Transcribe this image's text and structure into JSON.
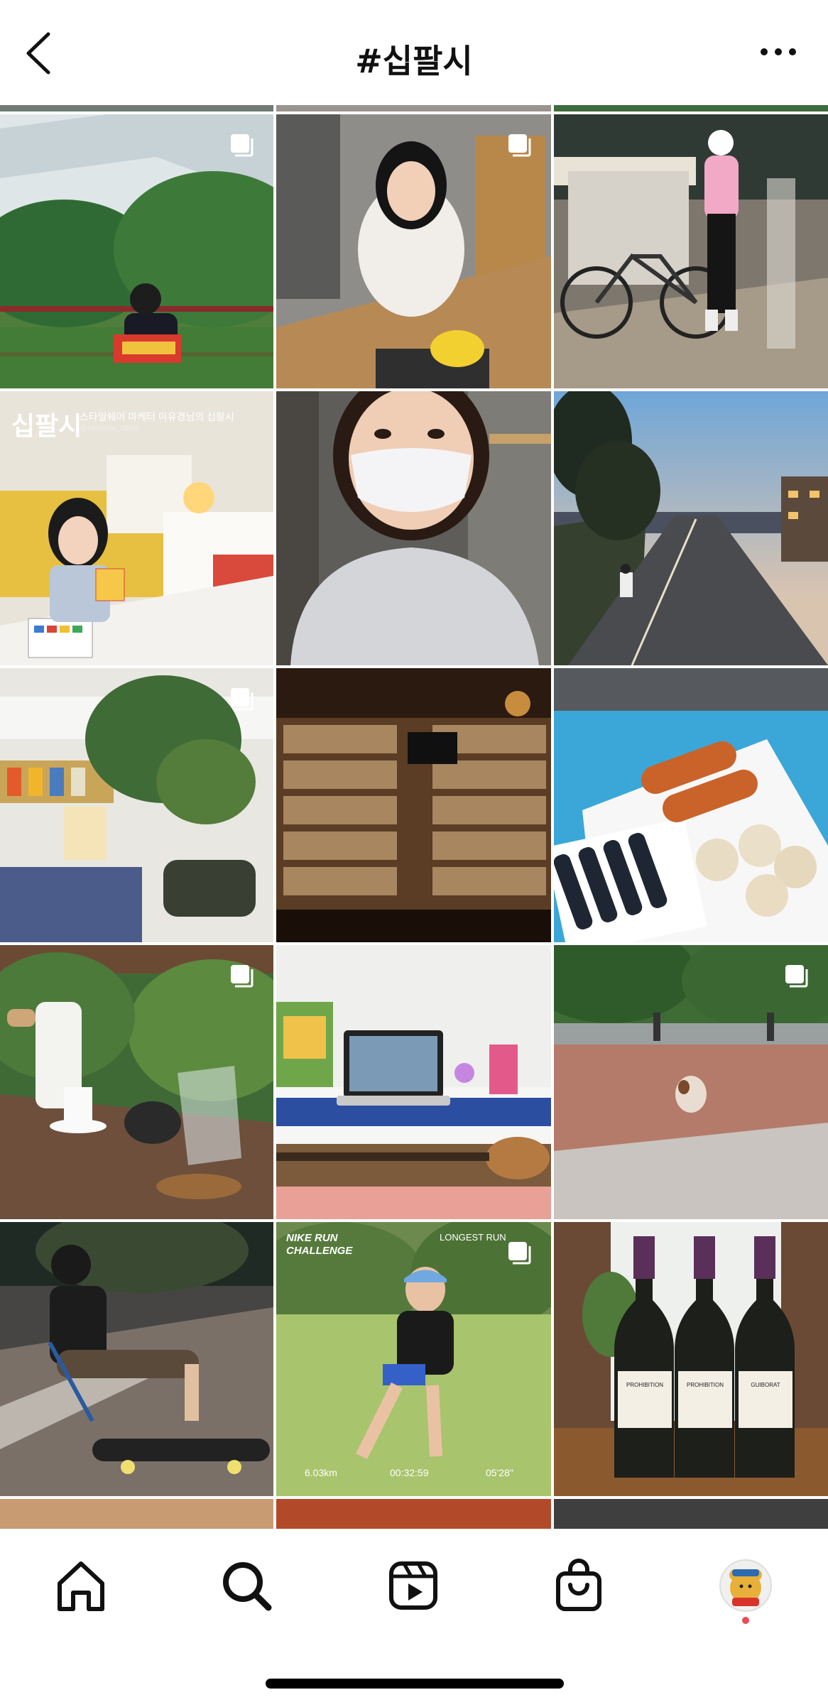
{
  "header": {
    "title": "#십팔시",
    "back_icon": "chevron-left-icon",
    "more_icon": "more-horizontal-icon"
  },
  "grid": {
    "tiles": [
      {
        "name": "tile-woman-window-forest",
        "multi": true
      },
      {
        "name": "tile-woman-crafting-workshop",
        "multi": true
      },
      {
        "name": "tile-cyclist-night-street",
        "multi": false
      },
      {
        "name": "tile-woman-painting-bed",
        "multi": false,
        "overlay_title": "십팔시",
        "overlay_caption": "스타일쉐어 마케터 이유경님의 십팔시",
        "overlay_handle": "@newnew_claire"
      },
      {
        "name": "tile-masked-selfie",
        "multi": false
      },
      {
        "name": "tile-evening-road-walk",
        "multi": false
      },
      {
        "name": "tile-cafe-bookstore-interior",
        "multi": true
      },
      {
        "name": "tile-record-shelf-bar",
        "multi": false
      },
      {
        "name": "tile-corndogs-dumplings",
        "multi": false
      },
      {
        "name": "tile-tea-table-garden",
        "multi": true
      },
      {
        "name": "tile-laptop-ukulele-desk",
        "multi": false
      },
      {
        "name": "tile-dog-running-park",
        "multi": true
      },
      {
        "name": "tile-man-skateboard-night",
        "multi": false
      },
      {
        "name": "tile-woman-stretching-run",
        "multi": true,
        "overlay_left": "NIKE RUN CHALLENGE",
        "overlay_right": "LONGEST RUN",
        "stat_1": "6.03km",
        "stat_2": "00:32:59",
        "stat_3": "05'28\""
      },
      {
        "name": "tile-champagne-bottles",
        "multi": false,
        "label_1": "PROHIBITION",
        "label_2": "PROHIBITION",
        "label_3": "GUIBORAT"
      }
    ]
  },
  "tabbar": {
    "items": [
      {
        "icon": "home-icon"
      },
      {
        "icon": "search-icon"
      },
      {
        "icon": "reels-icon"
      },
      {
        "icon": "shop-bag-icon"
      },
      {
        "icon": "profile-avatar-icon"
      }
    ]
  },
  "colors": {
    "notification_dot": "#ed4956",
    "text": "#111111"
  }
}
